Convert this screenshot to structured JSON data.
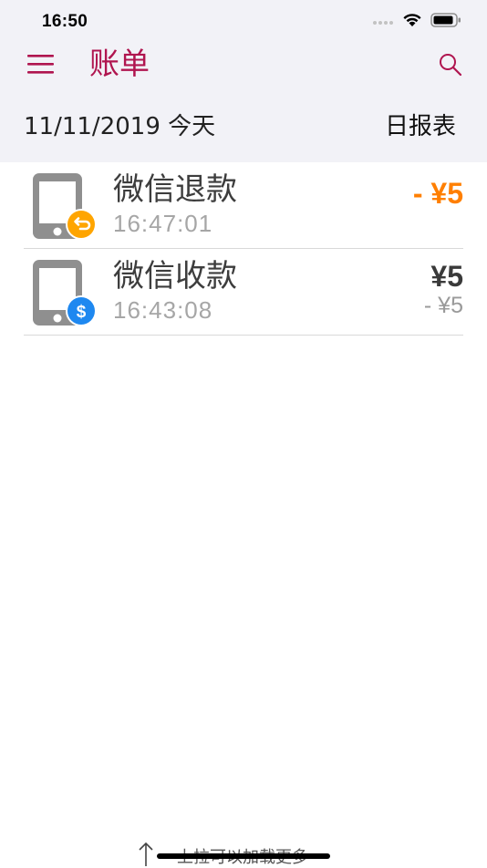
{
  "status_bar": {
    "time": "16:50",
    "icons": [
      "cellular-icon",
      "wifi-icon",
      "battery-icon"
    ]
  },
  "nav": {
    "title": "账单",
    "menu_icon": "hamburger-menu-icon",
    "search_icon": "search-icon"
  },
  "date_header": {
    "date": "11/11/2019 今天",
    "report_label": "日报表"
  },
  "transactions": [
    {
      "title": "微信退款",
      "time": "16:47:01",
      "amount": "- ¥5",
      "sub_amount": "",
      "badge_icon": "refund-arrow-icon",
      "badge_color": "#ffa500"
    },
    {
      "title": "微信收款",
      "time": "16:43:08",
      "amount": "¥5",
      "sub_amount": "- ¥5",
      "badge_icon": "dollar-icon",
      "badge_color": "#1e88f0"
    }
  ],
  "footer": {
    "load_more": "上拉可以加载更多"
  },
  "colors": {
    "accent": "#b0154f",
    "refund": "#ff7f00",
    "header_bg": "#f2f2f7"
  }
}
